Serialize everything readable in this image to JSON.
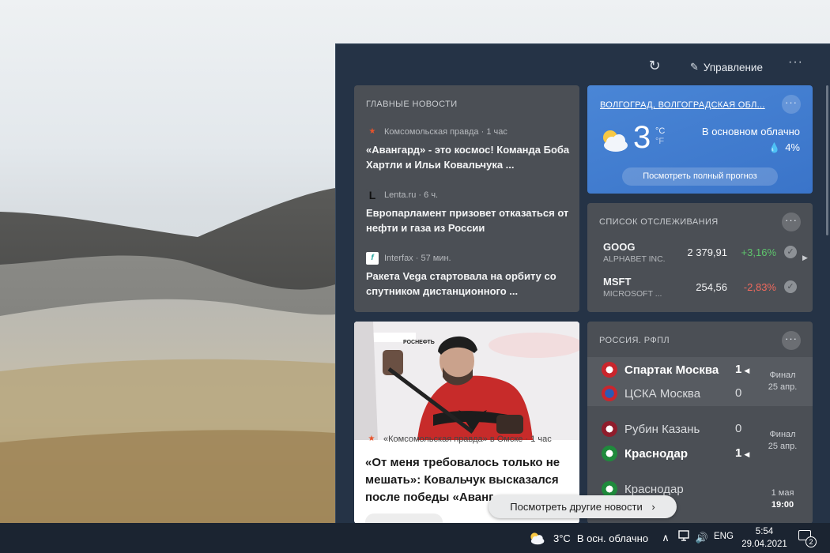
{
  "panel": {
    "manage_label": "Управление",
    "refresh_icon": "refresh-icon",
    "more_label": "···"
  },
  "top_news": {
    "title": "ГЛАВНЫЕ НОВОСТИ",
    "items": [
      {
        "source": "Комсомольская правда · 1 час",
        "headline": "«Авангард» - это космос! Команда Боба Хартли и Ильи Ковальчука ..."
      },
      {
        "source": "Lenta.ru · 6 ч.",
        "headline": "Европарламент призовет отказаться от нефти и газа из России"
      },
      {
        "source": "Interfax · 57 мин.",
        "headline": "Ракета Vega стартовала на орбиту со спутником дистанционного ..."
      }
    ]
  },
  "weather": {
    "location": "ВОЛГОГРАД, ВОЛГОГРАДСКАЯ ОБЛ...",
    "temp": "3",
    "unit_c": "°C",
    "unit_f": "°F",
    "condition": "В основном облачно",
    "precip": "4%",
    "forecast_button": "Посмотреть полный прогноз",
    "more": "···"
  },
  "watchlist": {
    "title": "СПИСОК ОТСЛЕЖИВАНИЯ",
    "more": "···",
    "stocks": [
      {
        "symbol": "GOOG",
        "name": "ALPHABET INC.",
        "price": "2 379,91",
        "change": "+3,16%"
      },
      {
        "symbol": "MSFT",
        "name": "MICROSOFT ...",
        "price": "254,56",
        "change": "-2,83%"
      }
    ]
  },
  "sports": {
    "title": "РОССИЯ. РФПЛ",
    "more": "···",
    "matches": [
      {
        "team1": "Спартак Москва",
        "score1": "1",
        "team2": "ЦСКА Москва",
        "score2": "0",
        "status1": "Финал",
        "status2": "25 апр."
      },
      {
        "team1": "Рубин Казань",
        "score1": "0",
        "team2": "Краснодар",
        "score2": "1",
        "status1": "Финал",
        "status2": "25 апр."
      },
      {
        "team1": "Краснодар",
        "status1": "1 мая",
        "status2": "19:00"
      }
    ]
  },
  "image_news": {
    "source": "«Комсомольская правда» в Омске · 1 час",
    "headline": "«От меня требовалось только не мешать»: Ковальчук высказался после победы «Аванг...",
    "photo_text": "РОСНЕФТЬ"
  },
  "more_news_button": "Посмотреть другие новости",
  "taskbar": {
    "weather_temp": "3°C",
    "weather_text": "В осн. облачно",
    "lang": "ENG",
    "time": "5:54",
    "date": "29.04.2021",
    "notifications": "2"
  }
}
